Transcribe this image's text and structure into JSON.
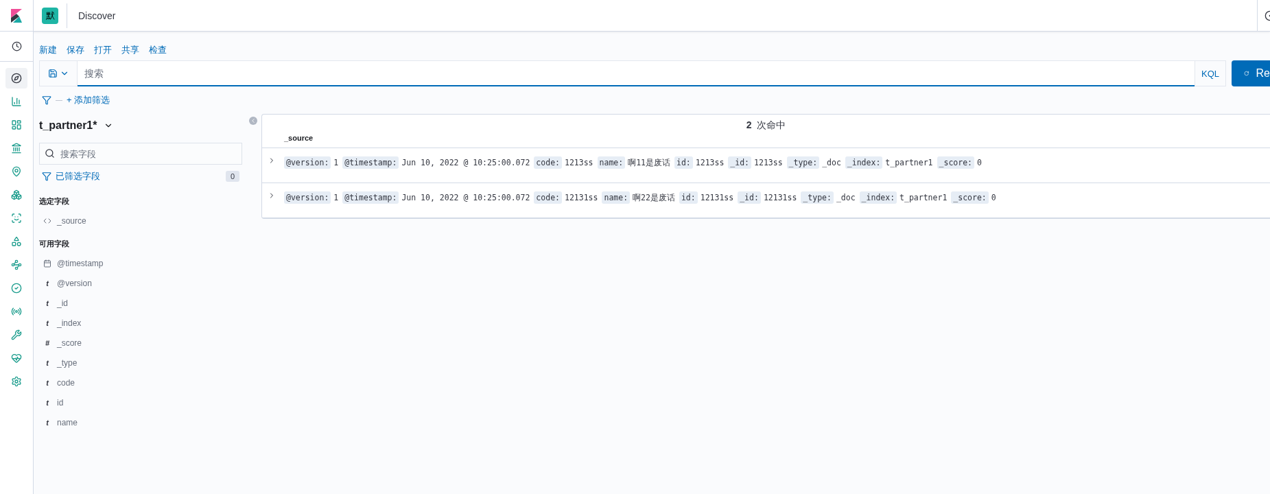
{
  "header": {
    "space_badge": "默",
    "title": "Discover"
  },
  "top_menu": [
    "新建",
    "保存",
    "打开",
    "共享",
    "检查"
  ],
  "query_bar": {
    "placeholder": "搜索",
    "language": "KQL",
    "submit_label": "Re"
  },
  "filter_bar": {
    "add_label": "+ 添加筛选"
  },
  "sidebar": {
    "index_pattern": "t_partner1*",
    "search_placeholder": "搜索字段",
    "filtered_label": "已筛选字段",
    "filtered_count": "0",
    "selected_title": "选定字段",
    "selected_fields": [
      {
        "kind": "source",
        "name": "_source"
      }
    ],
    "available_title": "可用字段",
    "available_fields": [
      {
        "kind": "date",
        "name": "@timestamp"
      },
      {
        "kind": "string",
        "glyph": "t",
        "name": "@version"
      },
      {
        "kind": "string",
        "glyph": "t",
        "name": "_id"
      },
      {
        "kind": "string",
        "glyph": "t",
        "name": "_index"
      },
      {
        "kind": "number",
        "glyph": "#",
        "name": "_score"
      },
      {
        "kind": "string",
        "glyph": "t",
        "name": "_type"
      },
      {
        "kind": "string",
        "glyph": "t",
        "name": "code"
      },
      {
        "kind": "string",
        "glyph": "t",
        "name": "id"
      },
      {
        "kind": "string",
        "glyph": "t",
        "name": "name"
      }
    ]
  },
  "results": {
    "hits_count": "2",
    "hits_label": "次命中",
    "column": "_source",
    "rows": [
      [
        {
          "key": "@version:",
          "value": "1"
        },
        {
          "key": "@timestamp:",
          "value": "Jun 10, 2022 @ 10:25:00.072"
        },
        {
          "key": "code:",
          "value": "1213ss"
        },
        {
          "key": "name:",
          "value": "啊11是废话"
        },
        {
          "key": "id:",
          "value": "1213ss"
        },
        {
          "key": "_id:",
          "value": "1213ss"
        },
        {
          "key": "_type:",
          "value": "_doc"
        },
        {
          "key": "_index:",
          "value": "t_partner1"
        },
        {
          "key": "_score:",
          "value": "0"
        }
      ],
      [
        {
          "key": "@version:",
          "value": "1"
        },
        {
          "key": "@timestamp:",
          "value": "Jun 10, 2022 @ 10:25:00.072"
        },
        {
          "key": "code:",
          "value": "12131ss"
        },
        {
          "key": "name:",
          "value": "啊22是废话"
        },
        {
          "key": "id:",
          "value": "12131ss"
        },
        {
          "key": "_id:",
          "value": "12131ss"
        },
        {
          "key": "_type:",
          "value": "_doc"
        },
        {
          "key": "_index:",
          "value": "t_partner1"
        },
        {
          "key": "_score:",
          "value": "0"
        }
      ]
    ]
  }
}
